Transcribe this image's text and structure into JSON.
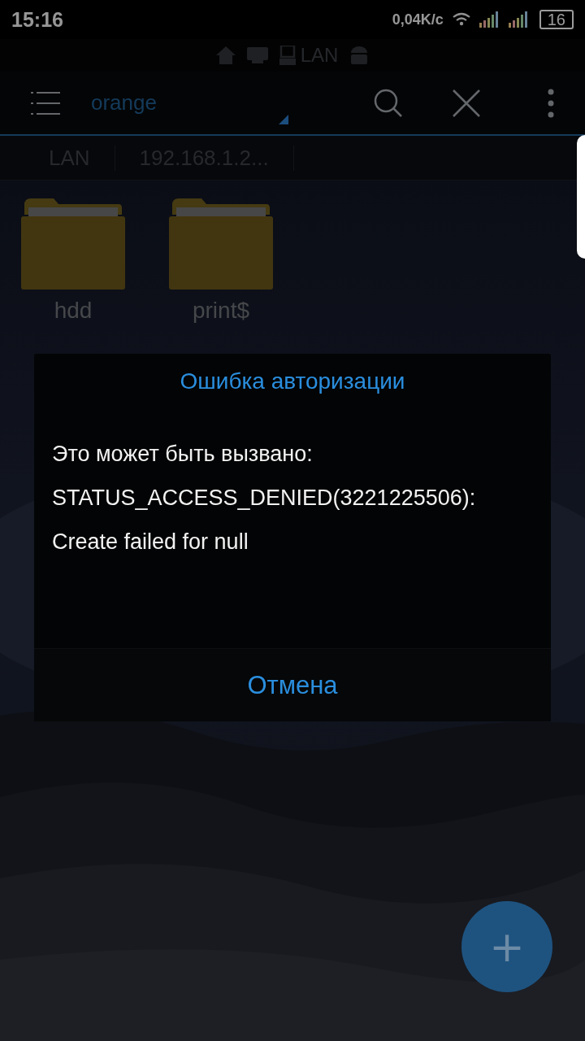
{
  "status_bar": {
    "time": "15:16",
    "speed": "0,04K/с",
    "battery": "16"
  },
  "location_tabs": {
    "label": "LAN"
  },
  "toolbar": {
    "title": "orange"
  },
  "breadcrumb": [
    "LAN",
    "192.168.1.2..."
  ],
  "folders": [
    {
      "name": "hdd"
    },
    {
      "name": "print$"
    }
  ],
  "dialog": {
    "title": "Ошибка авторизации",
    "lines": [
      "Это может быть вызвано:",
      "STATUS_ACCESS_DENIED(3221225506):",
      "Create failed for null"
    ],
    "button": "Отмена"
  },
  "fab": {
    "icon": "+"
  }
}
